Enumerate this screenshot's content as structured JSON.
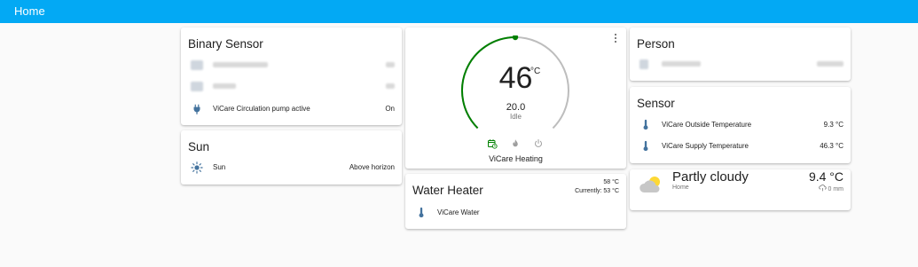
{
  "header": {
    "title": "Home"
  },
  "binary_sensor": {
    "title": "Binary Sensor",
    "rows": [
      {
        "name": "[blurred]",
        "state": "[blurred]",
        "icon": "blurred-icon"
      },
      {
        "name": "[blurred]",
        "state": "[blurred]",
        "icon": "blurred-icon"
      },
      {
        "name": "ViCare Circulation pump active",
        "state": "On",
        "icon": "power-plug-icon"
      }
    ]
  },
  "sun": {
    "title": "Sun",
    "rows": [
      {
        "name": "Sun",
        "state": "Above horizon",
        "icon": "sun-icon"
      }
    ]
  },
  "thermostat": {
    "current_temp": "46",
    "unit": "°C",
    "target_temp": "20.0",
    "action": "Idle",
    "name": "ViCare Heating",
    "modes": [
      "calendar-clock-icon",
      "flame-icon",
      "power-icon"
    ],
    "active_mode": "calendar-clock-icon",
    "accent": "#008000"
  },
  "water_heater": {
    "title": "Water Heater",
    "name": "ViCare Water",
    "target": "58 °C",
    "current": "Currently: 53 °C",
    "icon": "thermometer-icon"
  },
  "person": {
    "title": "Person",
    "rows": [
      {
        "name": "[blurred]",
        "state": "[blurred]",
        "icon": "blurred-icon"
      }
    ]
  },
  "sensor": {
    "title": "Sensor",
    "rows": [
      {
        "name": "ViCare Outside Temperature",
        "state": "9.3 °C",
        "icon": "thermometer-icon"
      },
      {
        "name": "ViCare Supply Temperature",
        "state": "46.3 °C",
        "icon": "thermometer-icon"
      }
    ]
  },
  "weather": {
    "condition": "Partly cloudy",
    "location": "Home",
    "temperature": "9.4 °C",
    "precipitation": "0 mm",
    "icon": "partly-cloudy-icon"
  },
  "colors": {
    "header": "#03a9f4",
    "icon": "#44739e",
    "state_active": "#fdd835"
  }
}
